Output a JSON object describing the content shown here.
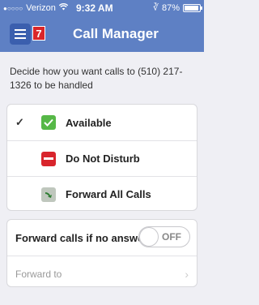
{
  "status": {
    "carrier": "Verizon",
    "signal_dots": "●○○○○",
    "time": "9:32 AM",
    "battery": "87%"
  },
  "nav": {
    "title": "Call Manager",
    "badge_count": "7"
  },
  "description": "Decide how you want calls to (510) 217-1326 to be handled",
  "options": [
    {
      "label": "Available",
      "selected": true,
      "check": "✓"
    },
    {
      "label": "Do Not Disturb",
      "selected": false
    },
    {
      "label": "Forward All Calls",
      "selected": false
    }
  ],
  "no_answer": {
    "label": "Forward calls if no answer",
    "toggle_text": "OFF",
    "forward_to_label": "Forward to"
  },
  "colors": {
    "nav_bg": "#5e80c4",
    "badge": "#d9262a",
    "available": "#56b847",
    "dnd": "#d8252c"
  }
}
